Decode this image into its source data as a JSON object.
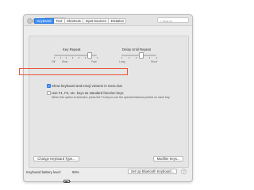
{
  "window": {
    "title": "Keyboard"
  },
  "toolbar": {
    "back_glyph": "‹",
    "forward_glyph": "›",
    "search_placeholder": "Search",
    "search_icon": "magnifier-icon"
  },
  "tabs": [
    {
      "label": "Keyboard",
      "active": true
    },
    {
      "label": "Text",
      "active": false
    },
    {
      "label": "Shortcuts",
      "active": false
    },
    {
      "label": "Input Sources",
      "active": false
    },
    {
      "label": "Dictation",
      "active": false
    }
  ],
  "key_repeat": {
    "label": "Key Repeat",
    "min_label": "Off",
    "slow_label": "Slow",
    "max_label": "Fast",
    "value": 0.82
  },
  "delay_until_repeat": {
    "label": "Delay Until Repeat",
    "min_label": "Long",
    "max_label": "Short",
    "value": 0.55
  },
  "options": {
    "show_viewers_label": "Show keyboard and emoji viewers in menu bar",
    "show_viewers_checked": true,
    "check_glyph": "✓",
    "fn_keys_label": "Use F1, F2, etc. keys as standard function keys",
    "fn_keys_checked": false,
    "fn_keys_note": "When this option is selected, press the Fn key to use the special features printed on each key."
  },
  "buttons": {
    "change_keyboard_type": "Change Keyboard Type...",
    "modifier_keys": "Modifier Keys...",
    "setup_bluetooth": "Set Up Bluetooth Keyboard...",
    "help": "?"
  },
  "battery": {
    "label": "Keyboard battery level:",
    "percent_text": "59%",
    "level": 0.59
  },
  "colors": {
    "accent": "#3b8ef4",
    "highlight_border": "#e8573a"
  }
}
